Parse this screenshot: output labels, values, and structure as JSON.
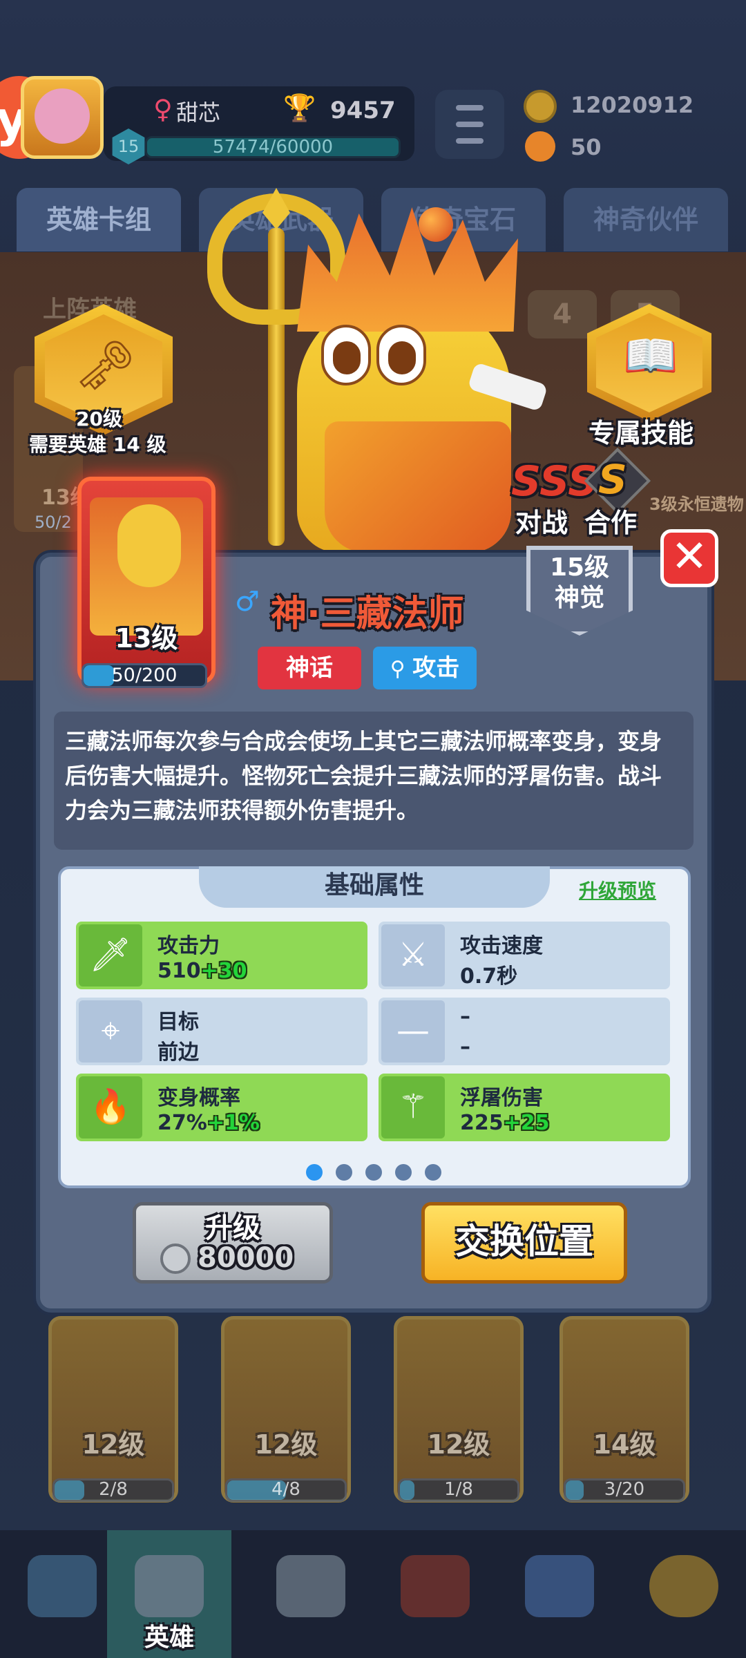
{
  "player": {
    "name": "甜芯",
    "trophies": "9457",
    "level": "15",
    "exp": "57474/60000",
    "coins": "12020912",
    "gems": "50"
  },
  "tabs": [
    "英雄卡组",
    "英雄武器",
    "传奇宝石",
    "神奇伙伴"
  ],
  "background": {
    "lineup_label": "上阵英雄",
    "slot_4": "4",
    "slot_5": "5",
    "level_left": "13级",
    "prog_left": "50/2",
    "relic_text": "3级永恒遗物"
  },
  "weapon_badge": {
    "level": "20级",
    "requirement": "需要英雄 14 级"
  },
  "skill_badge": {
    "label": "专属技能"
  },
  "rating": {
    "battle_grade": "SSS",
    "combo_grade": "S",
    "battle_label": "对战",
    "combo_label": "合作"
  },
  "hero_card": {
    "level": "13级",
    "progress": "50/200",
    "progress_fraction": 0.25
  },
  "dialog": {
    "awaken": "15级神觉",
    "gender": "♂",
    "name": "神·三藏法师",
    "tag_rarity": "神话",
    "tag_type": "攻击",
    "description": "三藏法师每次参与合成会使场上其它三藏法师概率变身，变身后伤害大幅提升。怪物死亡会提升三藏法师的浮屠伤害。战斗力会为三藏法师获得额外伤害提升。",
    "close_icon": "close-icon"
  },
  "stats": {
    "title": "基础属性",
    "preview": "升级预览",
    "items": [
      {
        "label": "攻击力",
        "value": "510",
        "bonus": "+30",
        "highlight": true
      },
      {
        "label": "攻击速度",
        "value": "0.7秒",
        "bonus": "",
        "highlight": false
      },
      {
        "label": "目标",
        "value": "前边",
        "bonus": "",
        "highlight": false
      },
      {
        "label": "–",
        "value": "–",
        "bonus": "",
        "highlight": false
      },
      {
        "label": "变身概率",
        "value": "27%",
        "bonus": "+1%",
        "highlight": true
      },
      {
        "label": "浮屠伤害",
        "value": "225",
        "bonus": "+25",
        "highlight": true
      }
    ],
    "page_count": 5,
    "active_page": 1
  },
  "buttons": {
    "upgrade": "升级",
    "upgrade_cost": "80000",
    "swap": "交换位置"
  },
  "bottom_cards": [
    {
      "level": "12级",
      "progress": "2/8",
      "fraction": 0.25
    },
    {
      "level": "12级",
      "progress": "4/8",
      "fraction": 0.5
    },
    {
      "level": "12级",
      "progress": "1/8",
      "fraction": 0.125
    },
    {
      "level": "14级",
      "progress": "3/20",
      "fraction": 0.15
    }
  ],
  "nav": {
    "active_label": "英雄"
  },
  "colors": {
    "mythic": "#e23440",
    "attack": "#2b9be6",
    "bonus": "#23d43a",
    "swap": "#f7b325"
  }
}
